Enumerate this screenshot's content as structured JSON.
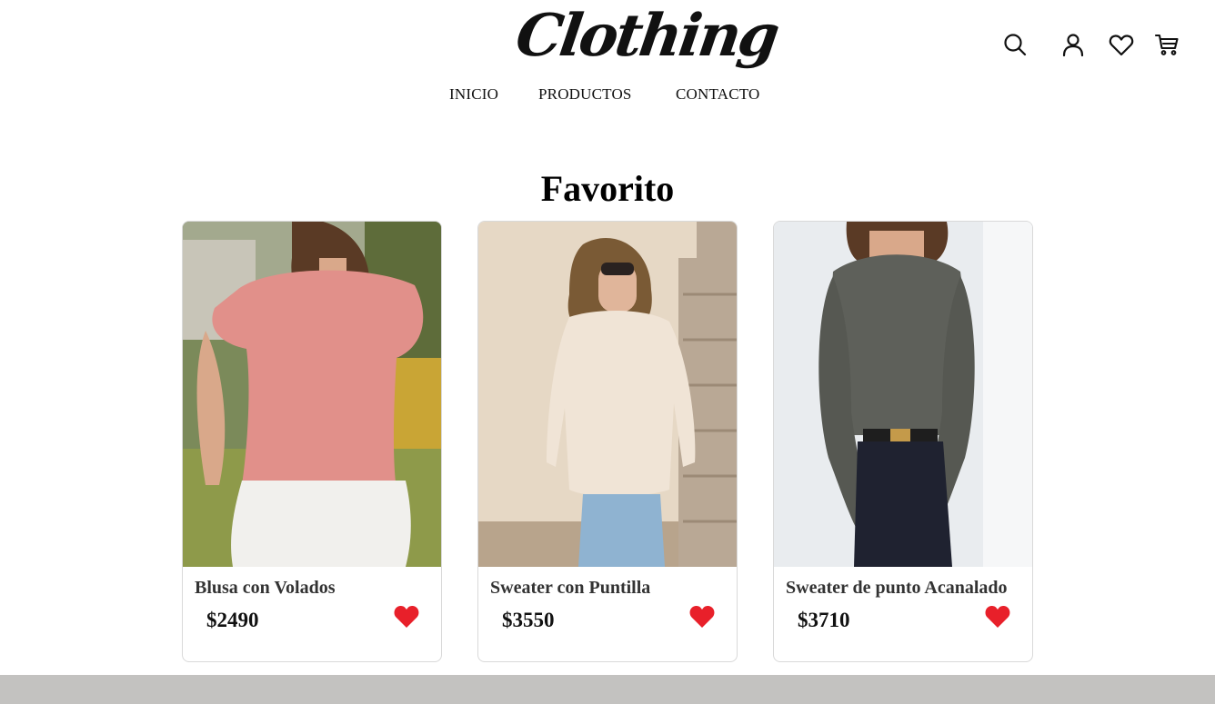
{
  "header": {
    "logo_text": "Clothing",
    "nav": [
      {
        "label": "INICIO"
      },
      {
        "label": "PRODUCTOS"
      },
      {
        "label": "CONTACTO"
      }
    ],
    "icons": [
      "search-icon",
      "user-icon",
      "heart-icon",
      "cart-icon"
    ]
  },
  "main": {
    "title": "Favorito",
    "products": [
      {
        "name": "Blusa con Volados",
        "price": "$2490",
        "favorite": true
      },
      {
        "name": "Sweater con Puntilla",
        "price": "$3550",
        "favorite": true
      },
      {
        "name": "Sweater de punto Acanalado",
        "price": "$3710",
        "favorite": true
      }
    ]
  },
  "colors": {
    "favorite_heart": "#e8202a",
    "card_border": "#d9d9d9",
    "footer_bar": "#c3c2c0"
  }
}
